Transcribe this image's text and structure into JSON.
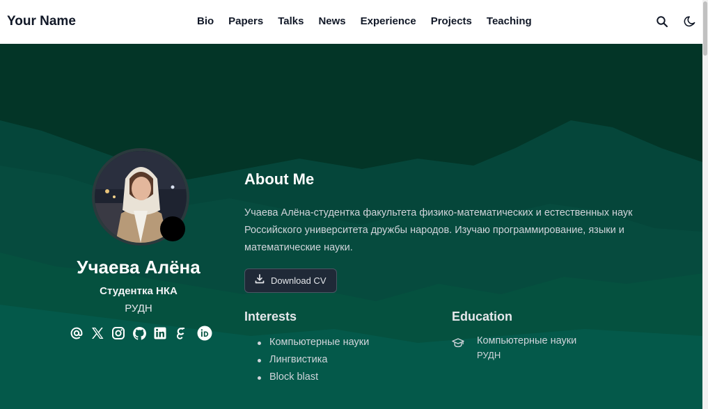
{
  "header": {
    "brand": "Your Name",
    "nav": [
      "Bio",
      "Papers",
      "Talks",
      "News",
      "Experience",
      "Projects",
      "Teaching"
    ],
    "icons": [
      "search-icon",
      "moon-icon"
    ]
  },
  "profile": {
    "name": "Учаева Алёна",
    "role": "Студентка НКА",
    "organization": "РУДН",
    "social_icons": [
      "email-icon",
      "x-twitter-icon",
      "instagram-icon",
      "github-icon",
      "linkedin-icon",
      "google-scholar-icon",
      "orcid-icon"
    ]
  },
  "about": {
    "title": "About Me",
    "text": "Учаева Алёна-студентка факультета физико-математических и естественных наук Российского университета дружбы народов. Изучаю программирование, языки и математические науки.",
    "cv_button": "Download CV"
  },
  "interests": {
    "title": "Interests",
    "items": [
      "Компьютерные науки",
      "Лингвистика",
      "Block blast"
    ]
  },
  "education": {
    "title": "Education",
    "course": "Компьютерные науки",
    "institution": "РУДН"
  },
  "colors": {
    "hero_dark": "#053f30",
    "hero_light": "#04594a",
    "button_bg": "#1f2937"
  }
}
